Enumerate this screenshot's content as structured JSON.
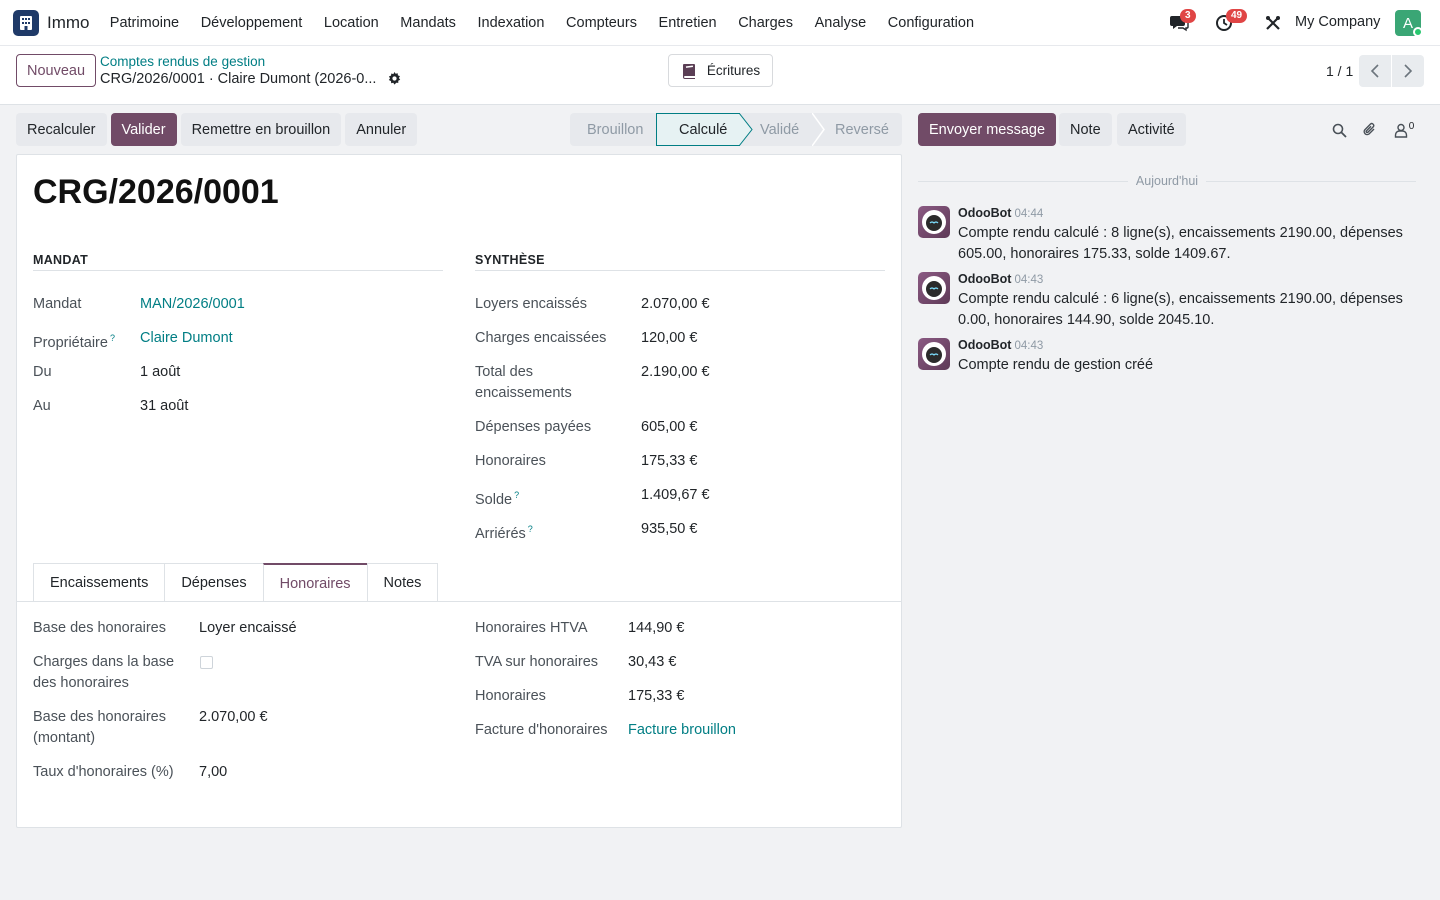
{
  "app": {
    "name": "Immo"
  },
  "menu": [
    "Patrimoine",
    "Développement",
    "Location",
    "Mandats",
    "Indexation",
    "Compteurs",
    "Entretien",
    "Charges",
    "Analyse",
    "Configuration"
  ],
  "systray": {
    "messages_count": "3",
    "activities_count": "49",
    "company": "My Company",
    "avatar_letter": "A"
  },
  "control": {
    "new_label": "Nouveau",
    "breadcrumb_parent": "Comptes rendus de gestion",
    "breadcrumb_current": "CRG/2026/0001 · Claire Dumont (2026-0...",
    "ecritures_label": "Écritures",
    "pager": "1 / 1"
  },
  "actions": {
    "recalc": "Recalculer",
    "validate": "Valider",
    "reset": "Remettre en brouillon",
    "cancel": "Annuler"
  },
  "stages": [
    "Brouillon",
    "Calculé",
    "Validé",
    "Reversé"
  ],
  "form": {
    "title": "CRG/2026/0001",
    "mandat_section": "MANDAT",
    "synthese_section": "SYNTHÈSE",
    "mandat": {
      "label": "Mandat",
      "value": "MAN/2026/0001"
    },
    "proprietaire": {
      "label": "Propriétaire",
      "value": "Claire Dumont"
    },
    "du": {
      "label": "Du",
      "value": "1 août"
    },
    "au": {
      "label": "Au",
      "value": "31 août"
    },
    "synthese": {
      "loyers": {
        "label": "Loyers encaissés",
        "value": "2.070,00 €"
      },
      "charges": {
        "label": "Charges encaissées",
        "value": "120,00 €"
      },
      "total_l1": "Total des",
      "total_l2": "encaissements",
      "total_value": "2.190,00 €",
      "depenses": {
        "label": "Dépenses payées",
        "value": "605,00 €"
      },
      "honoraires": {
        "label": "Honoraires",
        "value": "175,33 €"
      },
      "solde": {
        "label": "Solde",
        "value": "1.409,67 €"
      },
      "arrieres": {
        "label": "Arriérés",
        "value": "935,50 €"
      }
    },
    "tabs": [
      "Encaissements",
      "Dépenses",
      "Honoraires",
      "Notes"
    ],
    "hon": {
      "base_label": "Base des honoraires",
      "base_value": "Loyer encaissé",
      "charges_l1": "Charges dans la base",
      "charges_l2": "des honoraires",
      "montant_l1": "Base des honoraires",
      "montant_l2": "(montant)",
      "montant_value": "2.070,00 €",
      "taux_label": "Taux d'honoraires (%)",
      "taux_value": "7,00",
      "htva_label": "Honoraires HTVA",
      "htva_value": "144,90 €",
      "tva_label": "TVA sur honoraires",
      "tva_value": "30,43 €",
      "total_label": "Honoraires",
      "total_value": "175,33 €",
      "facture_label": "Facture d'honoraires",
      "facture_value": "Facture brouillon"
    }
  },
  "chatter": {
    "send_label": "Envoyer message",
    "note_label": "Note",
    "activity_label": "Activité",
    "followers_count": "0",
    "today": "Aujourd'hui",
    "messages": [
      {
        "author": "OdooBot",
        "time": "04:44",
        "body": "Compte rendu calculé : 8 ligne(s), encaissements 2190.00, dépenses 605.00, honoraires 175.33, solde 1409.67."
      },
      {
        "author": "OdooBot",
        "time": "04:43",
        "body": "Compte rendu calculé : 6 ligne(s), encaissements 2190.00, dépenses 0.00, honoraires 144.90, solde 2045.10."
      },
      {
        "author": "OdooBot",
        "time": "04:43",
        "body": "Compte rendu de gestion créé"
      }
    ]
  },
  "colors": {
    "primary": "#714b67",
    "link": "#017e84",
    "badge": "#e04545"
  }
}
